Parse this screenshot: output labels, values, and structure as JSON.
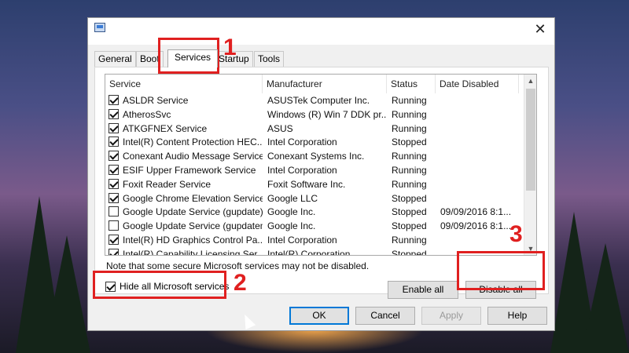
{
  "window": {
    "close_glyph": "✕"
  },
  "tabs": [
    {
      "label": "General"
    },
    {
      "label": "Boot"
    },
    {
      "label": "Services",
      "active": true
    },
    {
      "label": "Startup"
    },
    {
      "label": "Tools"
    }
  ],
  "columns": [
    "Service",
    "Manufacturer",
    "Status",
    "Date Disabled"
  ],
  "services": [
    {
      "checked": true,
      "service": "ASLDR Service",
      "manufacturer": "ASUSTek Computer Inc.",
      "status": "Running",
      "date_disabled": ""
    },
    {
      "checked": true,
      "service": "AtherosSvc",
      "manufacturer": "Windows (R) Win 7 DDK pr...",
      "status": "Running",
      "date_disabled": ""
    },
    {
      "checked": true,
      "service": "ATKGFNEX Service",
      "manufacturer": "ASUS",
      "status": "Running",
      "date_disabled": ""
    },
    {
      "checked": true,
      "service": "Intel(R) Content Protection HEC...",
      "manufacturer": "Intel Corporation",
      "status": "Stopped",
      "date_disabled": ""
    },
    {
      "checked": true,
      "service": "Conexant Audio Message Service",
      "manufacturer": "Conexant Systems Inc.",
      "status": "Running",
      "date_disabled": ""
    },
    {
      "checked": true,
      "service": "ESIF Upper Framework Service",
      "manufacturer": "Intel Corporation",
      "status": "Running",
      "date_disabled": ""
    },
    {
      "checked": true,
      "service": "Foxit Reader Service",
      "manufacturer": "Foxit Software Inc.",
      "status": "Running",
      "date_disabled": ""
    },
    {
      "checked": true,
      "service": "Google Chrome Elevation Service",
      "manufacturer": "Google LLC",
      "status": "Stopped",
      "date_disabled": ""
    },
    {
      "checked": false,
      "service": "Google Update Service (gupdate)",
      "manufacturer": "Google Inc.",
      "status": "Stopped",
      "date_disabled": "09/09/2016 8:1..."
    },
    {
      "checked": false,
      "service": "Google Update Service (gupdatem)",
      "manufacturer": "Google Inc.",
      "status": "Stopped",
      "date_disabled": "09/09/2016 8:1..."
    },
    {
      "checked": true,
      "service": "Intel(R) HD Graphics Control Pa...",
      "manufacturer": "Intel Corporation",
      "status": "Running",
      "date_disabled": ""
    },
    {
      "checked": true,
      "service": "Intel(R) Capability Licensing Ser...",
      "manufacturer": "Intel(R) Corporation",
      "status": "Stopped",
      "date_disabled": ""
    }
  ],
  "note": "Note that some secure Microsoft services may not be disabled.",
  "buttons": {
    "enable_all": "Enable all",
    "disable_all": "Disable all",
    "ok": "OK",
    "cancel": "Cancel",
    "apply": "Apply",
    "help": "Help"
  },
  "hide_ms": {
    "label": "Hide all Microsoft services",
    "checked": true
  },
  "annotations": [
    "1",
    "2",
    "3"
  ],
  "colors": {
    "annotation": "#e02020",
    "accent": "#0078d7"
  }
}
